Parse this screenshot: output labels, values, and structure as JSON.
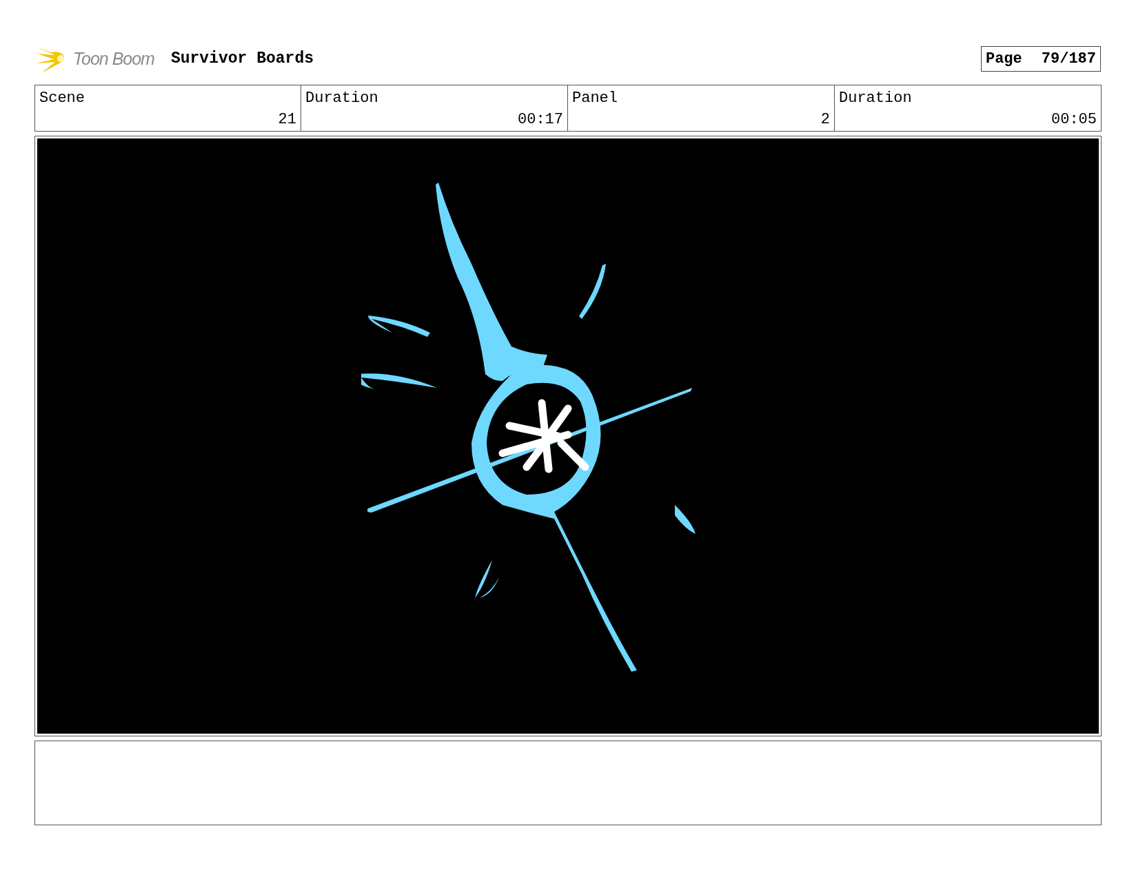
{
  "header": {
    "logo_text": "Toon Boom",
    "project_title": "Survivor Boards",
    "page_label": "Page",
    "page_number": "79/187"
  },
  "info_table": {
    "label_row": [
      "Scene",
      "Duration",
      "Panel",
      "Duration"
    ],
    "value_row": [
      "21",
      "00:17",
      "2",
      "00:05"
    ]
  }
}
